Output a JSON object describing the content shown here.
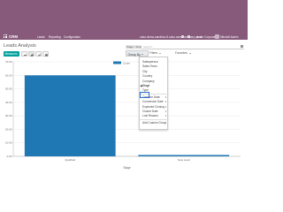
{
  "navbar": {
    "app_name": "CRM",
    "menu": [
      "Leads",
      "Reporting",
      "Configuration"
    ],
    "database": "odoo-demo-sandbox-8.odoo.acme-company-prod",
    "company": "Acme Corporation",
    "user": "Mitchell Admin",
    "color": "#875a7b"
  },
  "control_panel": {
    "title": "Leads Analysis",
    "measures_label": "Measures",
    "measures_color": "#00a09d",
    "search": {
      "facet": "Stage > Expected R...",
      "placeholder": "Search..."
    },
    "filters_label": "Filters",
    "groupby_label": "Group By",
    "favorites_label": "Favorites"
  },
  "groupby_menu": {
    "items": [
      {
        "label": "Salesperson"
      },
      {
        "label": "Sales Team"
      },
      {
        "label": "City"
      },
      {
        "label": "Country"
      },
      {
        "label": "Company"
      },
      {
        "label": "Stage",
        "selected": true
      },
      {
        "label": "Type"
      }
    ],
    "date_items": [
      {
        "label": "Creation Date"
      },
      {
        "label": "Conversion Date"
      },
      {
        "label": "Expected Closing"
      },
      {
        "label": "Closed Date"
      },
      {
        "label": "Lost Reason"
      }
    ],
    "custom_label": "Add Custom Group"
  },
  "chart_data": {
    "type": "bar",
    "categories": [
      "Qualified",
      "New Lead"
    ],
    "series": [
      {
        "name": "Count",
        "values": [
          60,
          1
        ],
        "color": "#1f77b4"
      }
    ],
    "xlabel": "Stage",
    "ylabel": "",
    "ylim": [
      0,
      70
    ],
    "yticks": [
      "0.00",
      "10.00",
      "20.00",
      "30.00",
      "40.00",
      "50.00",
      "60.00",
      "70.00"
    ],
    "grid": true,
    "legend_position": "top-right"
  }
}
